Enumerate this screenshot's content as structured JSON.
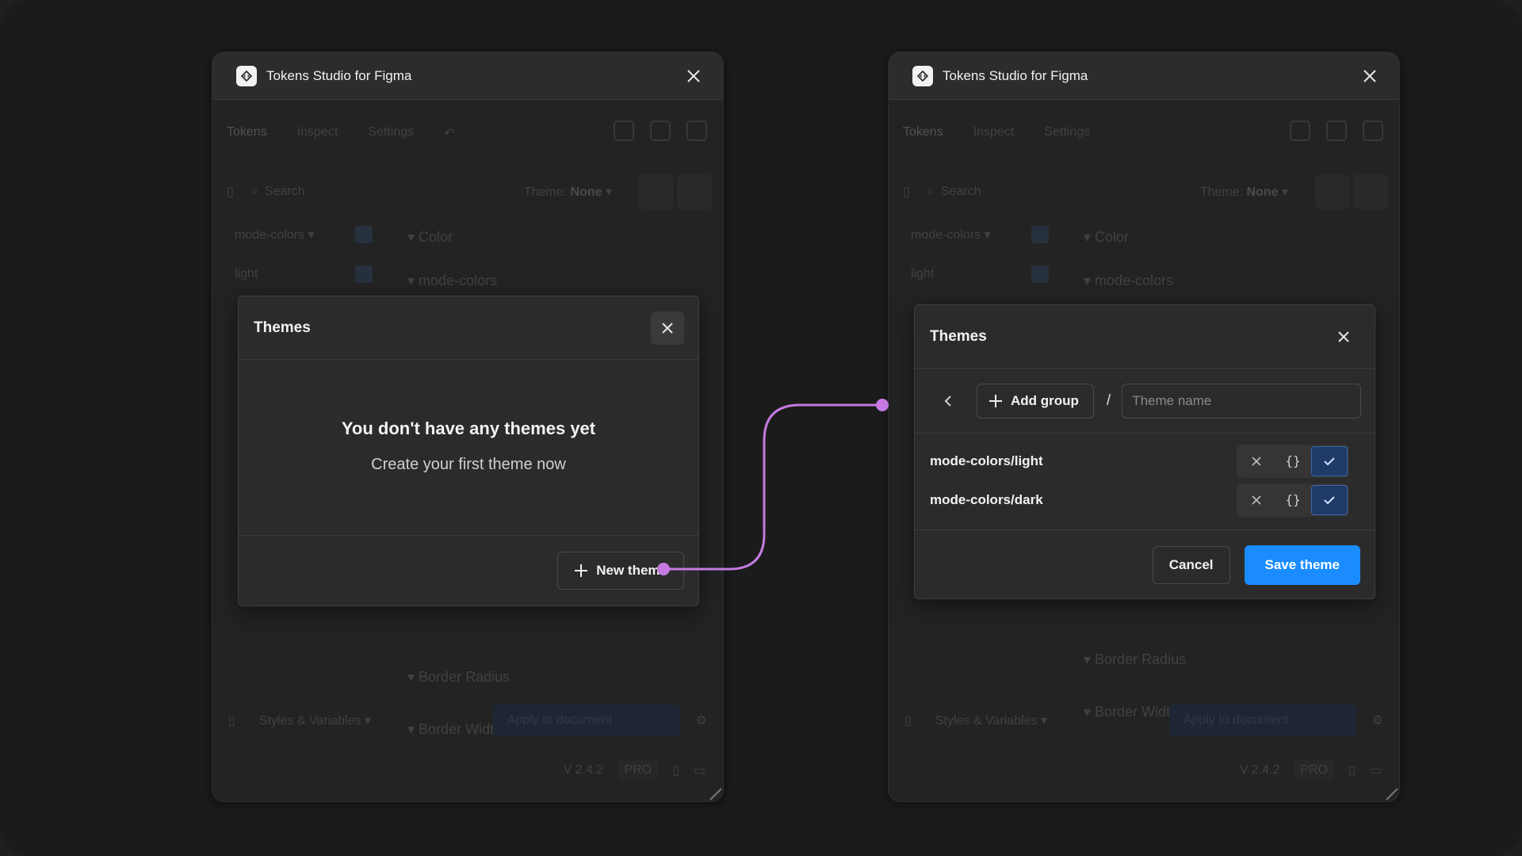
{
  "app": {
    "title": "Tokens Studio for Figma",
    "nav": [
      "Tokens",
      "Inspect",
      "Settings"
    ],
    "search_placeholder": "Search",
    "theme_label": "Theme:",
    "theme_value": "None",
    "sidebar": [
      {
        "label": "mode-colors",
        "suffix": "▾"
      },
      {
        "label": "light"
      }
    ],
    "groups": {
      "color": "Color",
      "mode_colors": "mode-colors",
      "border_radius": "Border Radius",
      "border_width": "Border Width"
    },
    "styles_label": "Styles & Variables",
    "apply_label": "Apply to document",
    "version": "V 2.4.2",
    "pro": "PRO"
  },
  "left_modal": {
    "title": "Themes",
    "empty_heading": "You don't have any themes yet",
    "empty_sub": "Create your first theme now",
    "new_theme": "New theme"
  },
  "right_modal": {
    "title": "Themes",
    "add_group": "Add group",
    "separator": "/",
    "name_placeholder": "Theme name",
    "sets": [
      {
        "name": "mode-colors/light",
        "state": "enabled"
      },
      {
        "name": "mode-colors/dark",
        "state": "enabled"
      }
    ],
    "cancel": "Cancel",
    "save": "Save theme"
  },
  "colors": {
    "accent": "#1a8cff",
    "connector": "#c47ae0",
    "enabled": "#1f3a66"
  }
}
